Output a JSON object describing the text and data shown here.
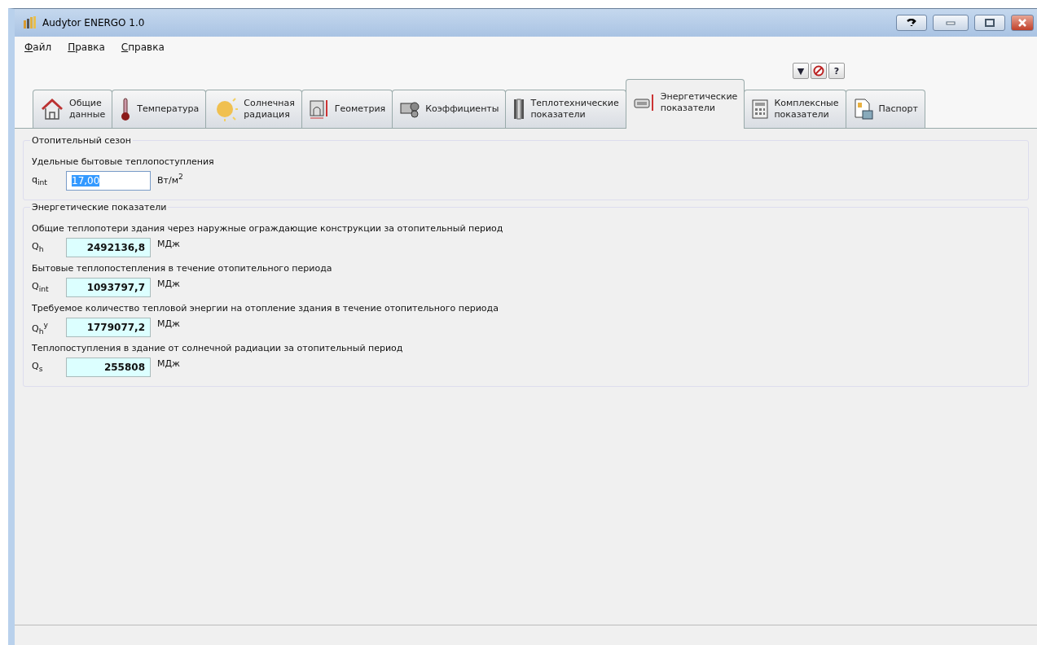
{
  "window": {
    "title": "Audytor ENERGO 1.0"
  },
  "menu": [
    "Файл",
    "Правка",
    "Справка"
  ],
  "toolbar": [
    {
      "label": "▼"
    },
    {
      "label": "?"
    }
  ],
  "tabs": [
    {
      "label": "Общие\nданные",
      "selected": false
    },
    {
      "label": "Температура",
      "selected": false
    },
    {
      "label": "Солнечная\nрадиация",
      "selected": false
    },
    {
      "label": "Геометрия",
      "selected": false
    },
    {
      "label": "Коэффициенты",
      "selected": false
    },
    {
      "label": "Теплотехнические\nпоказатели",
      "selected": false
    },
    {
      "label": "Энергетические\nпоказатели",
      "selected": true
    },
    {
      "label": "Комплексные\nпоказатели",
      "selected": false
    },
    {
      "label": "Паспорт",
      "selected": false
    }
  ],
  "groups": [
    {
      "title": "Отопительный сезон",
      "rows": [
        {
          "kind": "input",
          "caption": "Удельные бытовые теплопоступления",
          "symbol": "q$_{int}$",
          "value": "17,00",
          "text_selected": true,
          "unit": "Вт/м$^{2}$"
        }
      ]
    },
    {
      "title": "Энергетические показатели",
      "rows": [
        {
          "kind": "output",
          "caption": "Общие теплопотери здания через наружные ограждающие конструкции за отопительный период",
          "symbol": "Q$_{h}$",
          "value": "2492136,8",
          "unit": "МДж"
        },
        {
          "kind": "output",
          "caption": "Бытовые теплопостепления в течение отопительного периода",
          "symbol": "Q$_{int}$",
          "value": "1093797,7",
          "unit": "МДж"
        },
        {
          "kind": "output",
          "caption": "Требуемое количество тепловой энергии на отопление здания в течение отопительного периода",
          "symbol": "Q$_{h}$$^{y}$",
          "value": "1779077,2",
          "unit": "МДж"
        },
        {
          "kind": "output",
          "caption": "Теплопоступления в здание от солнечной радиации за отопительный период",
          "symbol": "Q$_{s}$",
          "value": "255808",
          "unit": "МДж"
        }
      ]
    }
  ]
}
